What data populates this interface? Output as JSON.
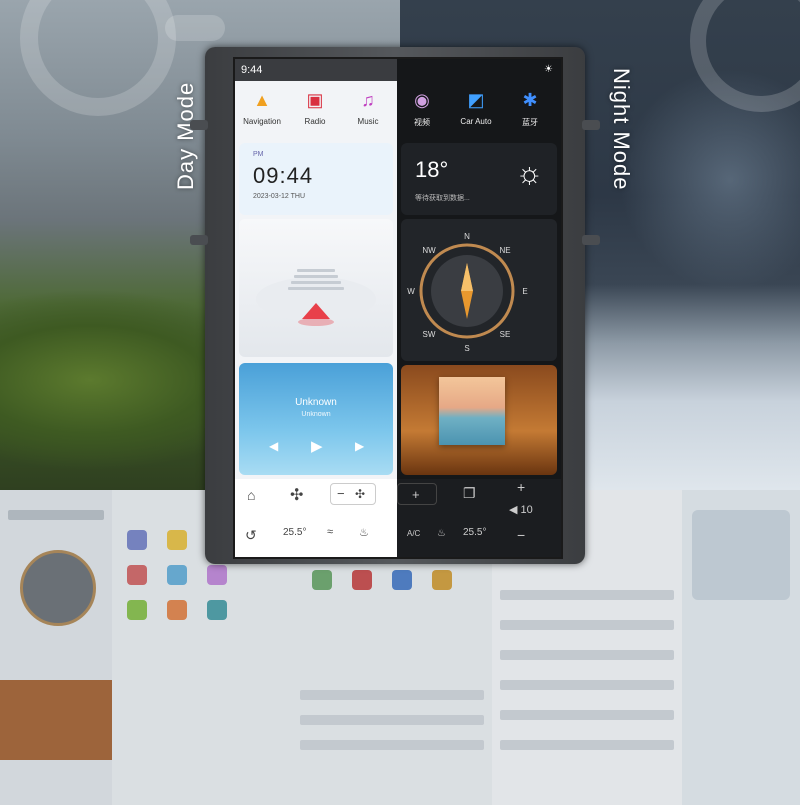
{
  "labels": {
    "day_mode": "Day Mode",
    "night_mode": "Night Mode"
  },
  "status": {
    "time": "9:44"
  },
  "day_apps": [
    {
      "label": "Navigation",
      "icon": "navigation-icon",
      "color": "#f0a020"
    },
    {
      "label": "Radio",
      "icon": "radio-icon",
      "color": "#d93040"
    },
    {
      "label": "Music",
      "icon": "music-icon",
      "color": "#c040c0"
    }
  ],
  "night_apps": [
    {
      "label": "视频",
      "icon": "video-icon",
      "color": "#d0a0e0"
    },
    {
      "label": "Car Auto",
      "icon": "car-auto-icon",
      "color": "#40a0ff"
    },
    {
      "label": "蓝牙",
      "icon": "bluetooth-icon",
      "color": "#4090ff"
    }
  ],
  "clock": {
    "ampm": "PM",
    "time": "09:44",
    "date": "2023-03-12   THU"
  },
  "weather": {
    "temp": "18°",
    "desc": "等待获取到数据..."
  },
  "compass": {
    "n": "N",
    "s": "S",
    "e": "E",
    "w": "W",
    "ne": "NE",
    "nw": "NW",
    "se": "SE",
    "sw": "SW"
  },
  "music": {
    "title": "Unknown",
    "artist": "Unknown"
  },
  "climate": {
    "left_temp": "25.5°",
    "right_temp": "25.5°",
    "ac": "A/C",
    "fan_level": "10",
    "minus": "−",
    "plus": "+"
  },
  "colors": {
    "accent_day": "#4aa0d8",
    "accent_night": "#c47a34"
  }
}
